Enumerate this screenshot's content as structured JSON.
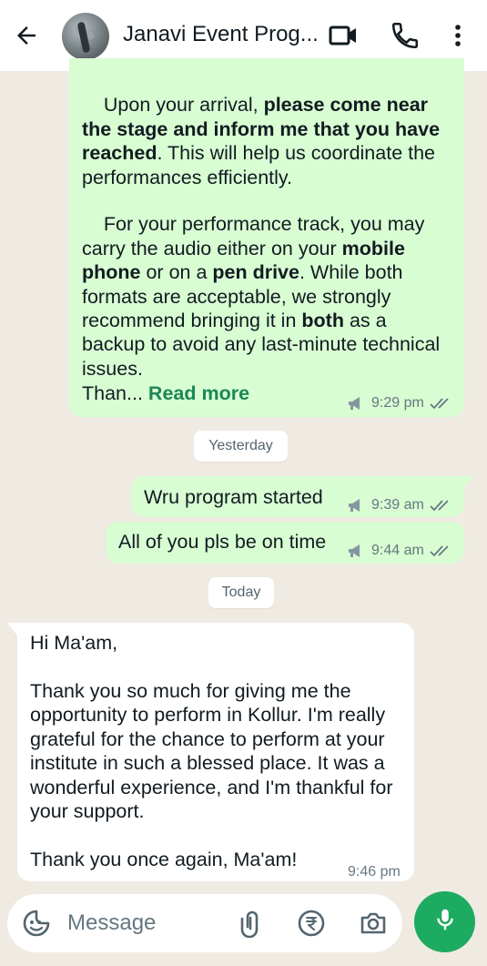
{
  "header": {
    "title": "Janavi Event Prog...",
    "back_icon": "arrow-left-icon",
    "video_icon": "video-camera-icon",
    "call_icon": "phone-icon",
    "menu_icon": "more-vertical-icon"
  },
  "messages": {
    "m1": {
      "seg1": "Upon your arrival, ",
      "seg2": "please come near the stage and inform me that you have reached",
      "seg3": ". This will help us coordinate the performances efficiently.",
      "seg4": "For your performance track, you may carry the audio either on your ",
      "seg5": "mobile phone",
      "seg6": " or on a ",
      "seg7": "pen drive",
      "seg8": ". While both formats are acceptable, we strongly recommend bringing it in ",
      "seg9": "both",
      "seg10": " as a backup to avoid any last-minute technical issues.",
      "seg11": "Than...",
      "read_more": "Read more",
      "time": "9:29 pm"
    },
    "date1": "Yesterday",
    "m2": {
      "text": "Wru  program started",
      "time": "9:39 am"
    },
    "m3": {
      "text": "All of you pls be on time",
      "time": "9:44 am"
    },
    "date2": "Today",
    "m4": {
      "p1": "Hi Ma'am,",
      "p2": "Thank you so much for giving me the opportunity to perform in Kollur. I'm really grateful for the chance to perform at your institute in such a blessed place. It was a wonderful experience, and I'm thankful for your support.",
      "p3": "Thank you once again, Ma'am!",
      "time": "9:46 pm"
    }
  },
  "composer": {
    "placeholder": "Message",
    "emoji_icon": "sticker-icon",
    "attach_icon": "paperclip-icon",
    "payment_icon": "rupee-icon",
    "camera_icon": "camera-icon",
    "mic_icon": "microphone-icon"
  },
  "colors": {
    "outgoing_bubble": "#d9fdd3",
    "incoming_bubble": "#ffffff",
    "chat_background": "#efeae2",
    "accent_green": "#1daa61",
    "read_more": "#1b8755"
  }
}
